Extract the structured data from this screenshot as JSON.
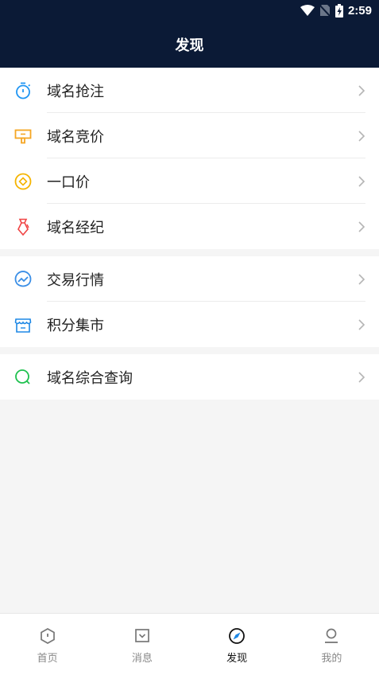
{
  "status_bar": {
    "time": "2:59"
  },
  "header": {
    "title": "发现"
  },
  "groups": [
    {
      "items": [
        {
          "label": "域名抢注",
          "icon": "timer-icon"
        },
        {
          "label": "域名竞价",
          "icon": "auction-sign-icon"
        },
        {
          "label": "一口价",
          "icon": "coin-icon"
        },
        {
          "label": "域名经纪",
          "icon": "necktie-icon"
        }
      ]
    },
    {
      "items": [
        {
          "label": "交易行情",
          "icon": "market-trend-icon"
        },
        {
          "label": "积分集市",
          "icon": "shop-icon"
        }
      ]
    },
    {
      "items": [
        {
          "label": "域名综合查询",
          "icon": "search-icon"
        }
      ]
    }
  ],
  "tabbar": {
    "tabs": [
      {
        "label": "首页",
        "icon": "home-icon"
      },
      {
        "label": "消息",
        "icon": "message-icon"
      },
      {
        "label": "发现",
        "icon": "compass-icon",
        "active": true
      },
      {
        "label": "我的",
        "icon": "user-icon"
      }
    ]
  },
  "colors": {
    "header_bg": "#0b1a36",
    "timer": "#2196f3",
    "auction": "#f5a623",
    "coin": "#f5b400",
    "necktie": "#f04545",
    "market": "#3a8ee6",
    "shop": "#1e88e5",
    "search": "#1fc14f"
  }
}
